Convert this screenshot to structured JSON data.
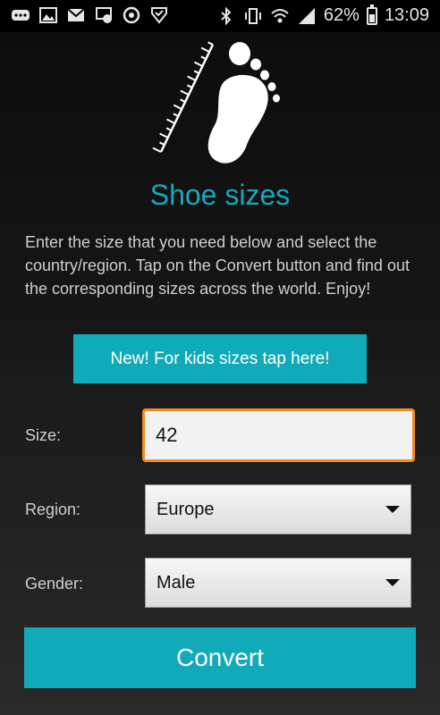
{
  "status_bar": {
    "battery": "62%",
    "battery_level": 0.62,
    "time": "13:09",
    "left_icons": [
      "more-icon",
      "gallery-icon",
      "gmail-icon",
      "cast-icon",
      "sync-icon",
      "checkin-icon"
    ],
    "right_icons": [
      "bluetooth-icon",
      "vibrate-icon",
      "wifi-icon",
      "signal-icon",
      "battery-icon"
    ]
  },
  "header": {
    "title": "Shoe sizes",
    "logo_icon": "foot-ruler-icon"
  },
  "intro": "Enter the size that you need below and select the country/region. Tap on the Convert button and find out the corresponding sizes across the world. Enjoy!",
  "kids_button": "New! For kids sizes tap here!",
  "form": {
    "size_label": "Size:",
    "size_value": "42",
    "region_label": "Region:",
    "region_value": "Europe",
    "gender_label": "Gender:",
    "gender_value": "Male"
  },
  "convert_button": "Convert",
  "colors": {
    "accent": "#11aab8",
    "focus_border": "#f08c1e",
    "background": "#141414"
  }
}
